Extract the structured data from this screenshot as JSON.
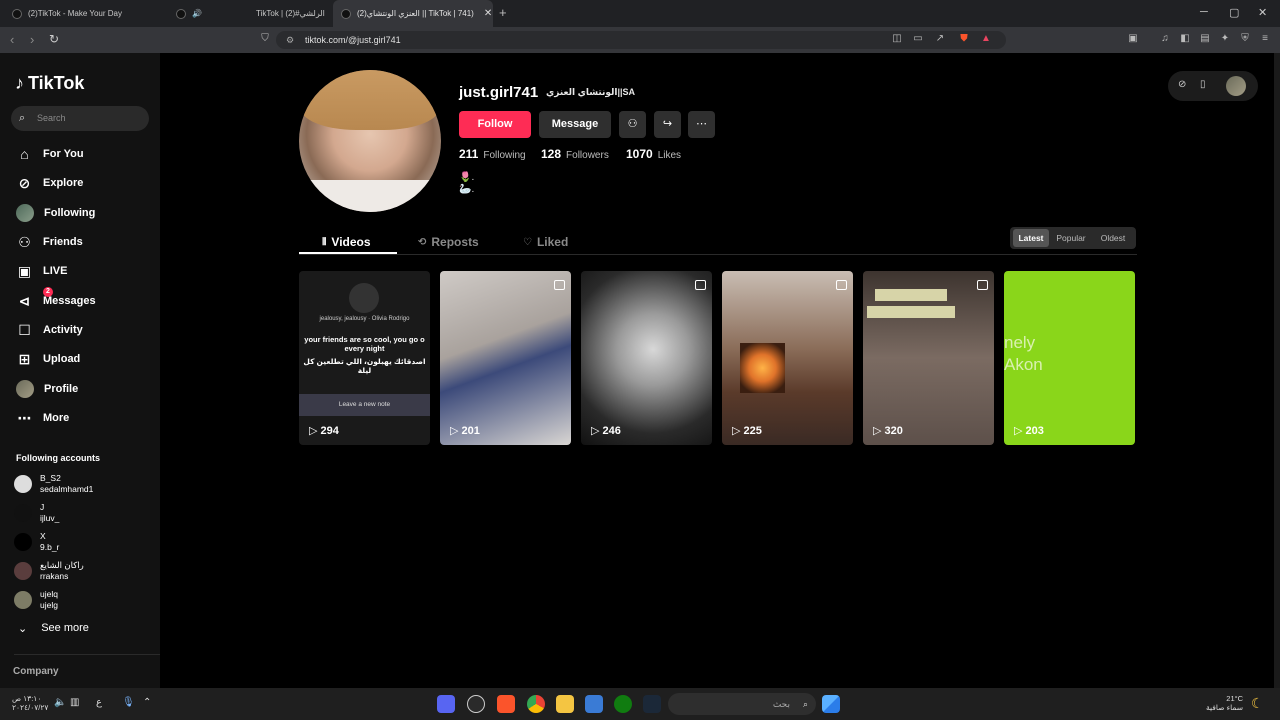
{
  "browser": {
    "tabs": [
      {
        "label": "(2)TikTok - Make Your Day"
      },
      {
        "label": "🔊"
      },
      {
        "label": "TikTok | الرلشي#(2)"
      },
      {
        "label": "(2)‏العنزي الونتشاي || TikTok | 741)"
      }
    ],
    "url": "tiktok.com/@just.girl741"
  },
  "sidebar": {
    "brand": "TikTok",
    "search_placeholder": "Search",
    "nav": [
      {
        "label": "For You",
        "icon": "home-icon"
      },
      {
        "label": "Explore",
        "icon": "compass-icon"
      },
      {
        "label": "Following",
        "icon": "avatar"
      },
      {
        "label": "Friends",
        "icon": "friends-icon"
      },
      {
        "label": "LIVE",
        "icon": "live-icon"
      },
      {
        "label": "Messages",
        "icon": "messages-icon",
        "badge": "2"
      },
      {
        "label": "Activity",
        "icon": "activity-icon"
      },
      {
        "label": "Upload",
        "icon": "upload-icon"
      },
      {
        "label": "Profile",
        "icon": "avatar"
      },
      {
        "label": "More",
        "icon": "more-icon"
      }
    ],
    "following_title": "Following accounts",
    "accounts": [
      {
        "display": "B_S2",
        "handle": "sedalmhamd1"
      },
      {
        "display": "J",
        "handle": "ijluv_"
      },
      {
        "display": "X",
        "handle": "9.b_r"
      },
      {
        "display": "راكان الشايع",
        "handle": "rrakans"
      },
      {
        "display": "ujelq",
        "handle": "ujelg"
      }
    ],
    "see_more": "See more",
    "company": "Company"
  },
  "profile": {
    "username": "just.girl741",
    "nickname": "الونتشاي العنزي||SA",
    "follow_label": "Follow",
    "message_label": "Message",
    "stats": {
      "following": "211",
      "following_label": "Following",
      "followers": "128",
      "followers_label": "Followers",
      "likes": "1070",
      "likes_label": "Likes"
    },
    "bio_line1": "🌷.",
    "bio_line2": "🦢."
  },
  "tabs": {
    "videos": "Videos",
    "reposts": "Reposts",
    "liked": "Liked"
  },
  "sort": {
    "latest": "Latest",
    "popular": "Popular",
    "oldest": "Oldest"
  },
  "videos": [
    {
      "views": "294",
      "caption1": "jealousy, jealousy · Olivia Rodrigo",
      "caption2": "your friends are so cool, you go o every night",
      "caption3": "اصدقائك يهبلون، اللي تطلعين كل ليلة",
      "caption4": "Leave a new note"
    },
    {
      "views": "201"
    },
    {
      "views": "246"
    },
    {
      "views": "225"
    },
    {
      "views": "320"
    },
    {
      "views": "203",
      "caption1": "nely",
      "caption2": "Akon"
    }
  ],
  "taskbar": {
    "search": "بحث",
    "time": "١٣:١٠ ص",
    "date": "٢٠٢٤/٠٧/٢٧",
    "temp": "21°C",
    "weather": "سماء صافية"
  }
}
